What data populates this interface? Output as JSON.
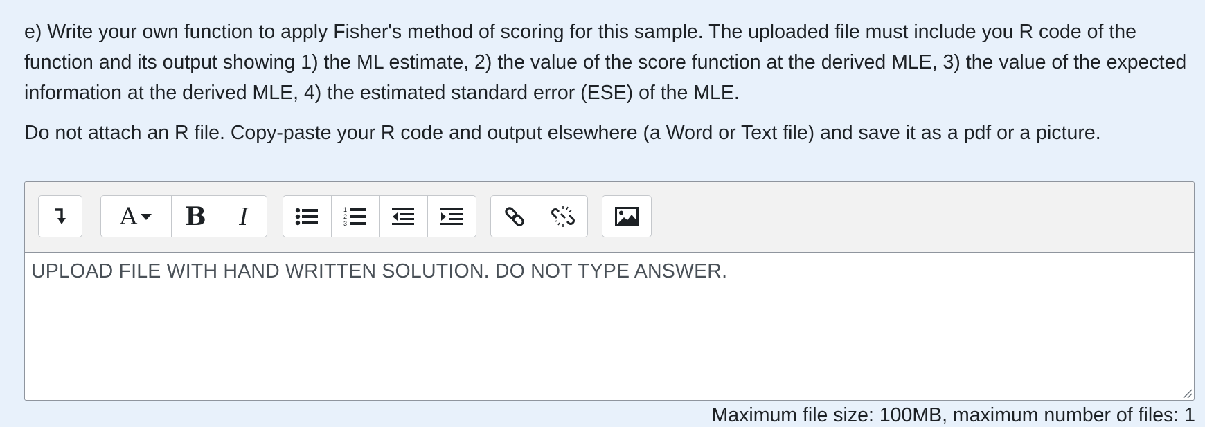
{
  "question": {
    "paragraph_1": "e) Write your own function to apply Fisher's method of scoring for this sample. The uploaded file must include you R code of the function and its output showing 1) the ML estimate, 2) the value of the score function at the derived MLE, 3) the value of the expected information at the derived MLE, 4) the estimated standard error (ESE) of the MLE.",
    "paragraph_2": "Do not attach an R file. Copy-paste your R code and output elsewhere (a Word or Text file) and save it as a pdf or a picture."
  },
  "toolbar": {
    "buttons": [
      {
        "group": 1,
        "icon": "toggle-toolbar-icon"
      },
      {
        "group": 2,
        "icon": "font-style-icon",
        "label": "A"
      },
      {
        "group": 2,
        "icon": "bold-icon",
        "label": "B"
      },
      {
        "group": 2,
        "icon": "italic-icon",
        "label": "I"
      },
      {
        "group": 3,
        "icon": "unordered-list-icon"
      },
      {
        "group": 3,
        "icon": "ordered-list-icon"
      },
      {
        "group": 3,
        "icon": "outdent-icon"
      },
      {
        "group": 3,
        "icon": "indent-icon"
      },
      {
        "group": 4,
        "icon": "link-icon"
      },
      {
        "group": 4,
        "icon": "unlink-icon"
      },
      {
        "group": 5,
        "icon": "image-icon"
      }
    ],
    "font_label": "A",
    "bold_label": "B",
    "italic_label": "I"
  },
  "editor": {
    "content": "UPLOAD FILE WITH HAND WRITTEN SOLUTION. DO NOT TYPE ANSWER."
  },
  "file_info": {
    "text": "Maximum file size: 100MB, maximum number of files: 1"
  },
  "colors": {
    "page_background": "#e8f1fb",
    "toolbar_background": "#f2f2f2",
    "border": "#8f959e",
    "icon": "#1d2125"
  }
}
